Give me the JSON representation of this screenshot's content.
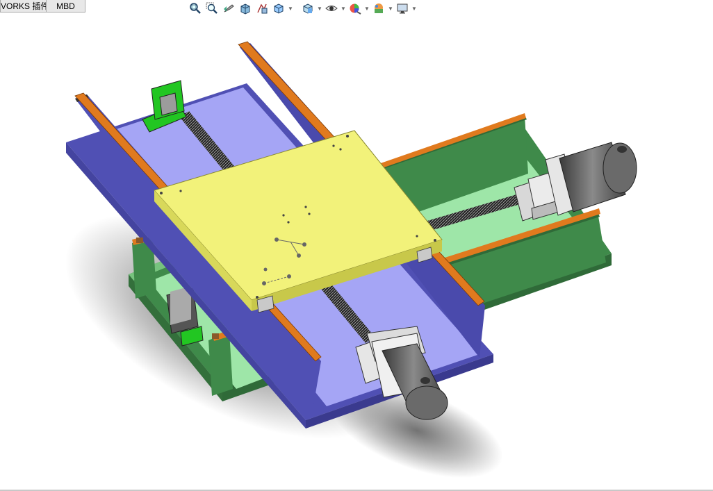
{
  "tabs": [
    {
      "label": "VORKS 插件"
    },
    {
      "label": "MBD"
    }
  ],
  "hud_tools": [
    {
      "icon": "zoom-to-fit-icon"
    },
    {
      "icon": "zoom-to-area-icon"
    },
    {
      "icon": "previous-view-icon"
    },
    {
      "icon": "section-view-icon"
    },
    {
      "icon": "dynamic-annotation-icon"
    },
    {
      "icon": "view-orientation-icon"
    },
    {
      "icon": "display-style-icon"
    },
    {
      "icon": "hide-show-items-icon"
    },
    {
      "icon": "edit-appearance-icon"
    },
    {
      "icon": "apply-scene-icon"
    },
    {
      "icon": "view-settings-icon"
    }
  ],
  "model": {
    "description_colors": {
      "base_green": "#3f8a4a",
      "base_light_green": "#9ee6a8",
      "middle_blue": "#5050b4",
      "middle_light_blue": "#a5a5f5",
      "top_plate_yellow": "#f2f27a",
      "rail_orange": "#e07a1e",
      "motor_gray": "#7a7a7a",
      "bearing_block_green": "#22c622"
    }
  }
}
